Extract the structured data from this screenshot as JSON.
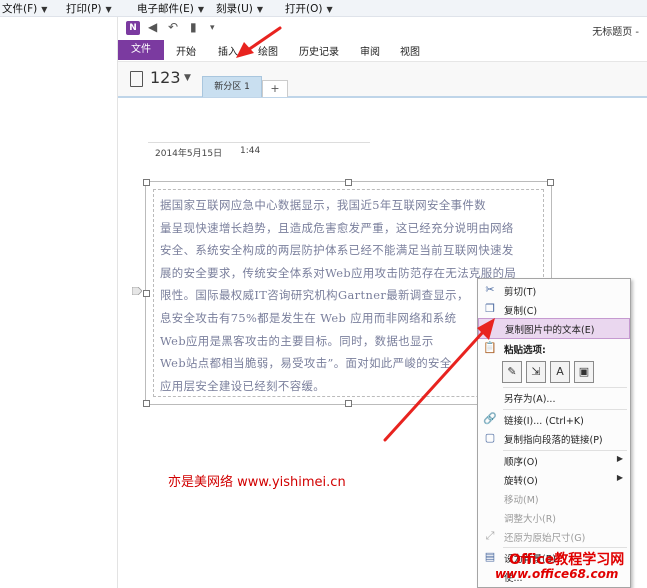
{
  "menubar": {
    "items": [
      "文件(F)",
      "打印(P)",
      "电子邮件(E)",
      "刻录(U)",
      "打开(O)"
    ]
  },
  "onenote": {
    "logo": "N",
    "doc_title": "无标题页 -",
    "ribbon_tabs": [
      "文件",
      "开始",
      "插入",
      "绘图",
      "历史记录",
      "审阅",
      "视图"
    ],
    "notebook_name": "123",
    "section_tab": "新分区 1",
    "add_tab": "+",
    "date": "2014年5月15日",
    "time": "1:44",
    "image_text": "据国家互联网应急中心数据显示，我国近5年互联网安全事件数\n量呈现快速增长趋势，且造成危害愈发严重，这已经充分说明由网络\n安全、系统安全构成的两层防护体系已经不能满足当前互联网快速发\n展的安全要求，传统安全体系对Web应用攻击防范存在无法克服的局\n限性。国际最权威IT咨询研究机构Gartner最新调查显示，\n息安全攻击有75%都是发生在 Web 应用而非网络和系统\nWeb应用是黑客攻击的主要目标。同时，数据也显示\nWeb站点都相当脆弱，易受攻击”。面对如此严峻的安全\n应用层安全建设已经刻不容缓。"
  },
  "context_menu": {
    "cut": "剪切(T)",
    "copy": "复制(C)",
    "copy_text_from_picture": "复制图片中的文本(E)",
    "paste_options": "粘贴选项:",
    "save_as": "另存为(A)...",
    "link": "链接(I)...  (Ctrl+K)",
    "copy_link_to_paragraph": "复制指向段落的链接(P)",
    "order": "顺序(O)",
    "rotate": "旋转(O)",
    "move": "移动(M)",
    "resize": "调整大小(R)",
    "restore_size": "还原为原始尺寸(G)",
    "set_as_background": "设为背景(B)",
    "last": "使..."
  },
  "watermarks": {
    "caption": "亦是美网络 www.yishimei.cn",
    "brand": "Office教程学习网",
    "site": "www.office68.com"
  },
  "colors": {
    "onenote_purple": "#7b3aa0",
    "highlight": "#ead7ef",
    "arrow_red": "#e8231f"
  }
}
